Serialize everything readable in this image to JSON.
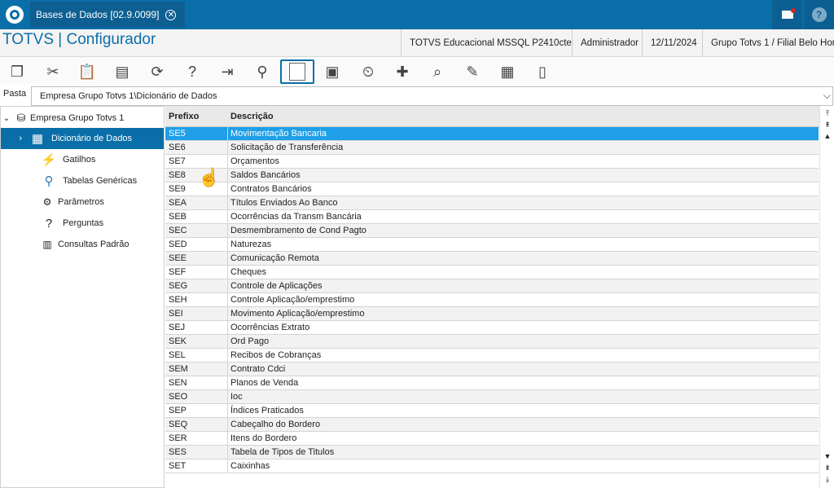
{
  "topbar": {
    "tab_title": "Bases de Dados [02.9.0099]",
    "close_glyph": "✕"
  },
  "header": {
    "app_title": "TOTVS | Configurador",
    "environment": "TOTVS Educacional MSSQL P2410cte",
    "user": "Administrador",
    "date": "12/11/2024",
    "company": "Grupo Totvs 1 / Filial Belo Hor"
  },
  "toolbar": {
    "icons": [
      "copy-icon",
      "cut-icon",
      "paste-icon",
      "pack-icon",
      "sync-icon",
      "help-icon",
      "exit-icon",
      "search-icon",
      "view-icon",
      "save-icon",
      "schedule-icon",
      "add-icon",
      "preview-icon",
      "edit-icon",
      "table-icon",
      "document-icon"
    ]
  },
  "pasta": {
    "label": "Pasta",
    "value": "Empresa Grupo Totvs 1\\Dicionário de Dados"
  },
  "tree": {
    "root": "Empresa Grupo Totvs 1",
    "items": [
      {
        "label": "Dicionário de Dados",
        "icon": "table-icon"
      },
      {
        "label": "Gatilhos",
        "icon": "lightning-icon"
      },
      {
        "label": "Tabelas Genéricas",
        "icon": "magnifier-icon"
      },
      {
        "label": "Parâmetros",
        "icon": "params-icon"
      },
      {
        "label": "Perguntas",
        "icon": "question-icon"
      },
      {
        "label": "Consultas Padrão",
        "icon": "query-icon"
      }
    ]
  },
  "grid": {
    "headers": [
      "Prefixo",
      "Descrição"
    ],
    "rows": [
      [
        "SE5",
        "Movimentação Bancaria"
      ],
      [
        "SE6",
        "Solicitação de Transferência"
      ],
      [
        "SE7",
        "Orçamentos"
      ],
      [
        "SE8",
        "Saldos Bancários"
      ],
      [
        "SE9",
        "Contratos Bancários"
      ],
      [
        "SEA",
        "Títulos Enviados Ao Banco"
      ],
      [
        "SEB",
        "Ocorrências da Transm Bancária"
      ],
      [
        "SEC",
        "Desmembramento de Cond Pagto"
      ],
      [
        "SED",
        "Naturezas"
      ],
      [
        "SEE",
        "Comunicação Remota"
      ],
      [
        "SEF",
        "Cheques"
      ],
      [
        "SEG",
        "Controle de Aplicações"
      ],
      [
        "SEH",
        "Controle Aplicação/emprestimo"
      ],
      [
        "SEI",
        "Movimento Aplicação/emprestimo"
      ],
      [
        "SEJ",
        "Ocorrências Extrato"
      ],
      [
        "SEK",
        "Ord Pago"
      ],
      [
        "SEL",
        "Recibos de Cobranças"
      ],
      [
        "SEM",
        "Contrato Cdci"
      ],
      [
        "SEN",
        "Planos de Venda"
      ],
      [
        "SEO",
        "Ioc"
      ],
      [
        "SEP",
        "Índices Praticados"
      ],
      [
        "SEQ",
        "Cabeçalho do Bordero"
      ],
      [
        "SER",
        "Itens do Bordero"
      ],
      [
        "SES",
        "Tabela de Tipos de Titulos"
      ],
      [
        "SET",
        "Caixinhas"
      ]
    ]
  },
  "colors": {
    "brand": "#0a6fa8",
    "selection": "#1e9fe8"
  }
}
